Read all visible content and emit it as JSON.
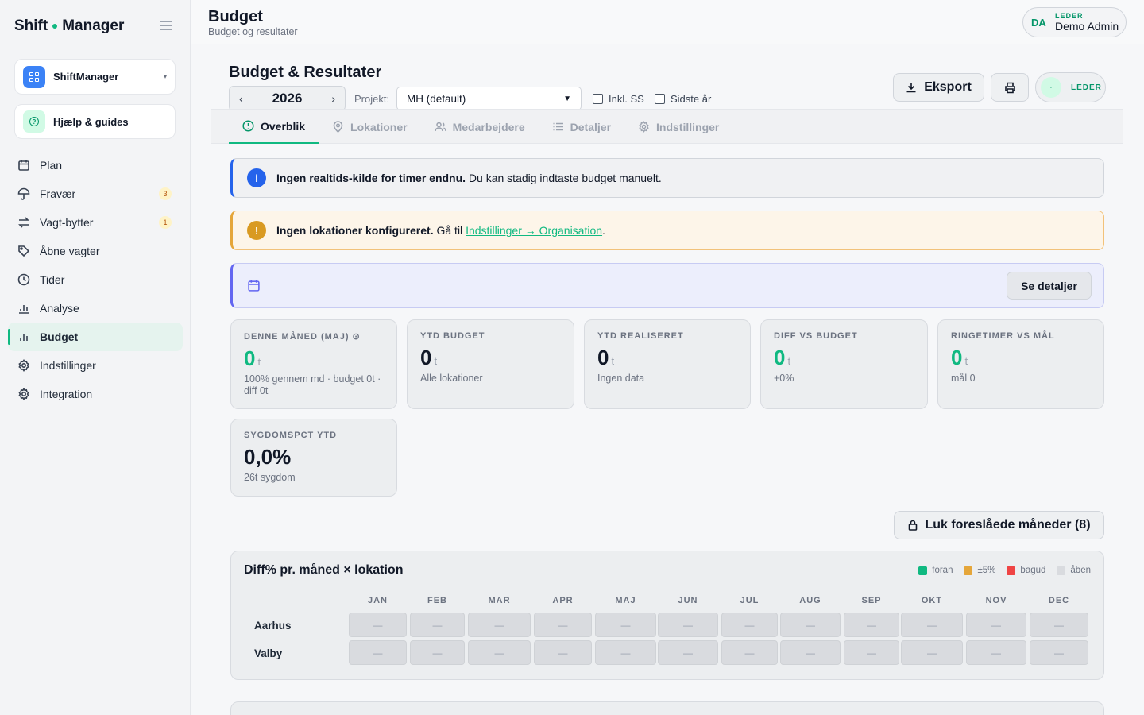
{
  "brand": {
    "word1": "Shift",
    "word2": "Manager",
    "dot_color": "#10b981"
  },
  "workspace": {
    "label": "ShiftManager"
  },
  "help": {
    "label": "Hjælp & guides"
  },
  "nav": [
    {
      "label": "Plan",
      "icon": "calendar-icon"
    },
    {
      "label": "Fravær",
      "icon": "umbrella-icon",
      "badge": "3"
    },
    {
      "label": "Vagt-bytter",
      "icon": "swap-icon",
      "badge": "1"
    },
    {
      "label": "Åbne vagter",
      "icon": "tag-icon"
    },
    {
      "label": "Tider",
      "icon": "clock-icon"
    },
    {
      "label": "Analyse",
      "icon": "bar-chart-icon"
    },
    {
      "label": "Budget",
      "icon": "bar-chart-icon",
      "active": true
    },
    {
      "label": "Indstillinger",
      "icon": "gear-icon"
    },
    {
      "label": "Integration",
      "icon": "gear-icon"
    }
  ],
  "header": {
    "title": "Budget",
    "subtitle": "Budget og resultater"
  },
  "user": {
    "initials": "DA",
    "role": "LEDER",
    "name": "Demo Admin"
  },
  "page": {
    "title": "Budget & Resultater",
    "year": "2026",
    "project_label": "Projekt:",
    "project_value": "MH (default)",
    "check_ss": "Inkl. SS",
    "check_last_year": "Sidste år",
    "export_label": "Eksport",
    "leader_label": "LEDER",
    "leader_avatar": "·"
  },
  "tabs": [
    {
      "label": "Overblik",
      "icon": "alert-circle-icon"
    },
    {
      "label": "Lokationer",
      "icon": "map-pin-icon"
    },
    {
      "label": "Medarbejdere",
      "icon": "users-icon"
    },
    {
      "label": "Detaljer",
      "icon": "list-icon"
    },
    {
      "label": "Indstillinger",
      "icon": "gear-icon"
    }
  ],
  "alerts": {
    "info_bold": "Ingen realtids-kilde for timer endnu.",
    "info_text": " Du kan stadig indtaste budget manuelt.",
    "warn_bold": "Ingen lokationer konfigureret.",
    "warn_text": " Gå til ",
    "warn_link": "Indstillinger → Organisation",
    "warn_end": ".",
    "see_details": "Se detaljer"
  },
  "kpis": [
    {
      "label": "DENNE MÅNED (MAJ) ⊙",
      "value": "0",
      "unit": "t",
      "sub": "100% gennem md · budget 0t · diff 0t",
      "green": true
    },
    {
      "label": "YTD BUDGET",
      "value": "0",
      "unit": "t",
      "sub": "Alle lokationer",
      "green": false
    },
    {
      "label": "YTD REALISERET",
      "value": "0",
      "unit": "t",
      "sub": "Ingen data",
      "green": false
    },
    {
      "label": "DIFF VS BUDGET",
      "value": "0",
      "unit": "t",
      "sub": "+0%",
      "green": true
    },
    {
      "label": "RINGETIMER VS MÅL",
      "value": "0",
      "unit": "t",
      "sub": "mål 0",
      "green": true
    },
    {
      "label": "SYGDOMSPCT YTD",
      "value": "0,0%",
      "unit": "",
      "sub": "26t sygdom",
      "green": false
    }
  ],
  "lock_button": "Luk foreslåede måneder (8)",
  "heatmap": {
    "title": "Diff% pr. måned × lokation",
    "legend": [
      {
        "label": "foran",
        "color": "#10b981"
      },
      {
        "label": "±5%",
        "color": "#e5a63a"
      },
      {
        "label": "bagud",
        "color": "#ef4444"
      },
      {
        "label": "åben",
        "color": "#d9dbdf"
      }
    ],
    "months": [
      "JAN",
      "FEB",
      "MAR",
      "APR",
      "MAJ",
      "JUN",
      "JUL",
      "AUG",
      "SEP",
      "OKT",
      "NOV",
      "DEC"
    ],
    "rows": [
      {
        "name": "Aarhus",
        "cells": [
          "—",
          "—",
          "—",
          "—",
          "—",
          "—",
          "—",
          "—",
          "—",
          "—",
          "—",
          "—"
        ]
      },
      {
        "name": "Valby",
        "cells": [
          "—",
          "—",
          "—",
          "—",
          "—",
          "—",
          "—",
          "—",
          "—",
          "—",
          "—",
          "—"
        ]
      }
    ]
  }
}
